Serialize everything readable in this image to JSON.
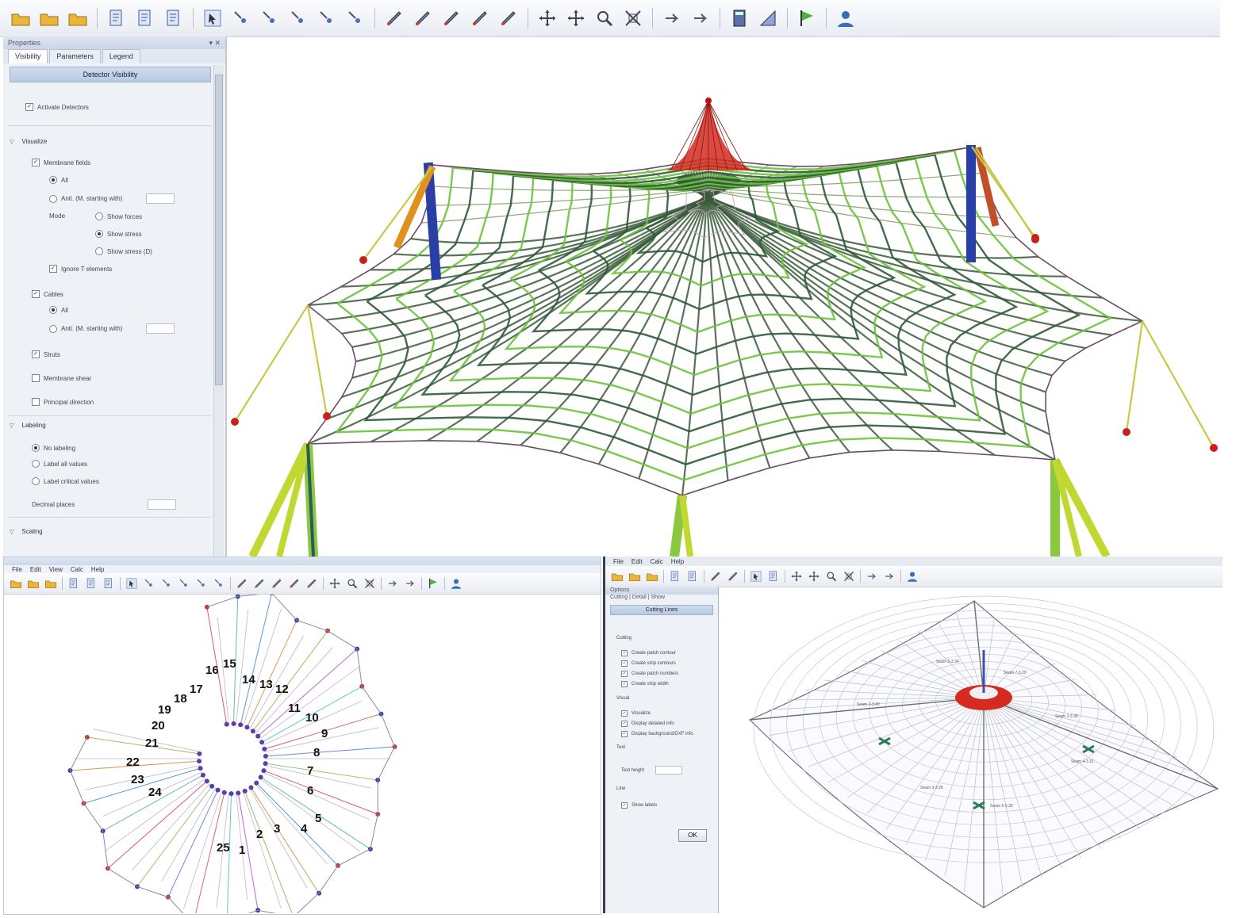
{
  "main_panel": {
    "title": "Properties",
    "tabs": [
      "Visibility",
      "Parameters",
      "Legend"
    ],
    "group_header": "Detector Visibility",
    "activate": "Activate Detectors",
    "sections": {
      "visualize": "Visualize",
      "labeling": "Labeling",
      "scaling": "Scaling"
    },
    "items": {
      "membrane_fields": "Membrane fields",
      "all": "All",
      "with_value": "Anti. (M. starting with)",
      "mode": "Mode",
      "show_forces": "Show forces",
      "show_stress": "Show stress",
      "show_stress_d": "Show stress (D)",
      "ignore_t": "Ignore T elements",
      "cables": "Cables",
      "cables_all": "All",
      "cables_with_value": "Anti. (M. starting with)",
      "struts": "Struts",
      "membrane_shear": "Membrane shear",
      "principal": "Principal direction",
      "no_labeling": "No labeling",
      "label_all": "Label all values",
      "label_critical": "Label critical values",
      "decimal_places": "Decimal places"
    }
  },
  "left_subwindow": {
    "menu": [
      "File",
      "Edit",
      "View",
      "Calc",
      "Help"
    ],
    "segment_labels": [
      "1",
      "2",
      "3",
      "4",
      "5",
      "6",
      "7",
      "8",
      "9",
      "10",
      "11",
      "12",
      "13",
      "14",
      "15",
      "16",
      "17",
      "18",
      "19",
      "20",
      "21",
      "22",
      "23",
      "24",
      "25"
    ]
  },
  "right_subwindow": {
    "menu": [
      "File",
      "Edit",
      "Calc",
      "Help"
    ],
    "panel_title": "Options",
    "panel_subtitle": "Cutting | Detail | Show",
    "group_header": "Cutting Lines",
    "sections": [
      "Cutting",
      "Visual",
      "Text",
      "Line"
    ],
    "items": [
      "Create patch contour",
      "Create strip contours",
      "Create patch numbers",
      "Create strip width",
      "Visualize",
      "Display detailed info",
      "Display background/DXF info",
      "Show labels"
    ],
    "text_size_label": "Text height",
    "ok_label": "OK",
    "edge_labels": [
      "Seam 1-3.40",
      "Seam 2-3.36",
      "Seam 3-3.28",
      "Seam 4-3.31",
      "Seam 5-3.34",
      "Seam 6-3.30",
      "Seam 7-3.29"
    ]
  },
  "colors": {
    "accent": "#3a6db5",
    "membrane_green": "#5fbf2a",
    "cone_red": "#d42a1f",
    "mast_blue": "#2a3fa6"
  }
}
